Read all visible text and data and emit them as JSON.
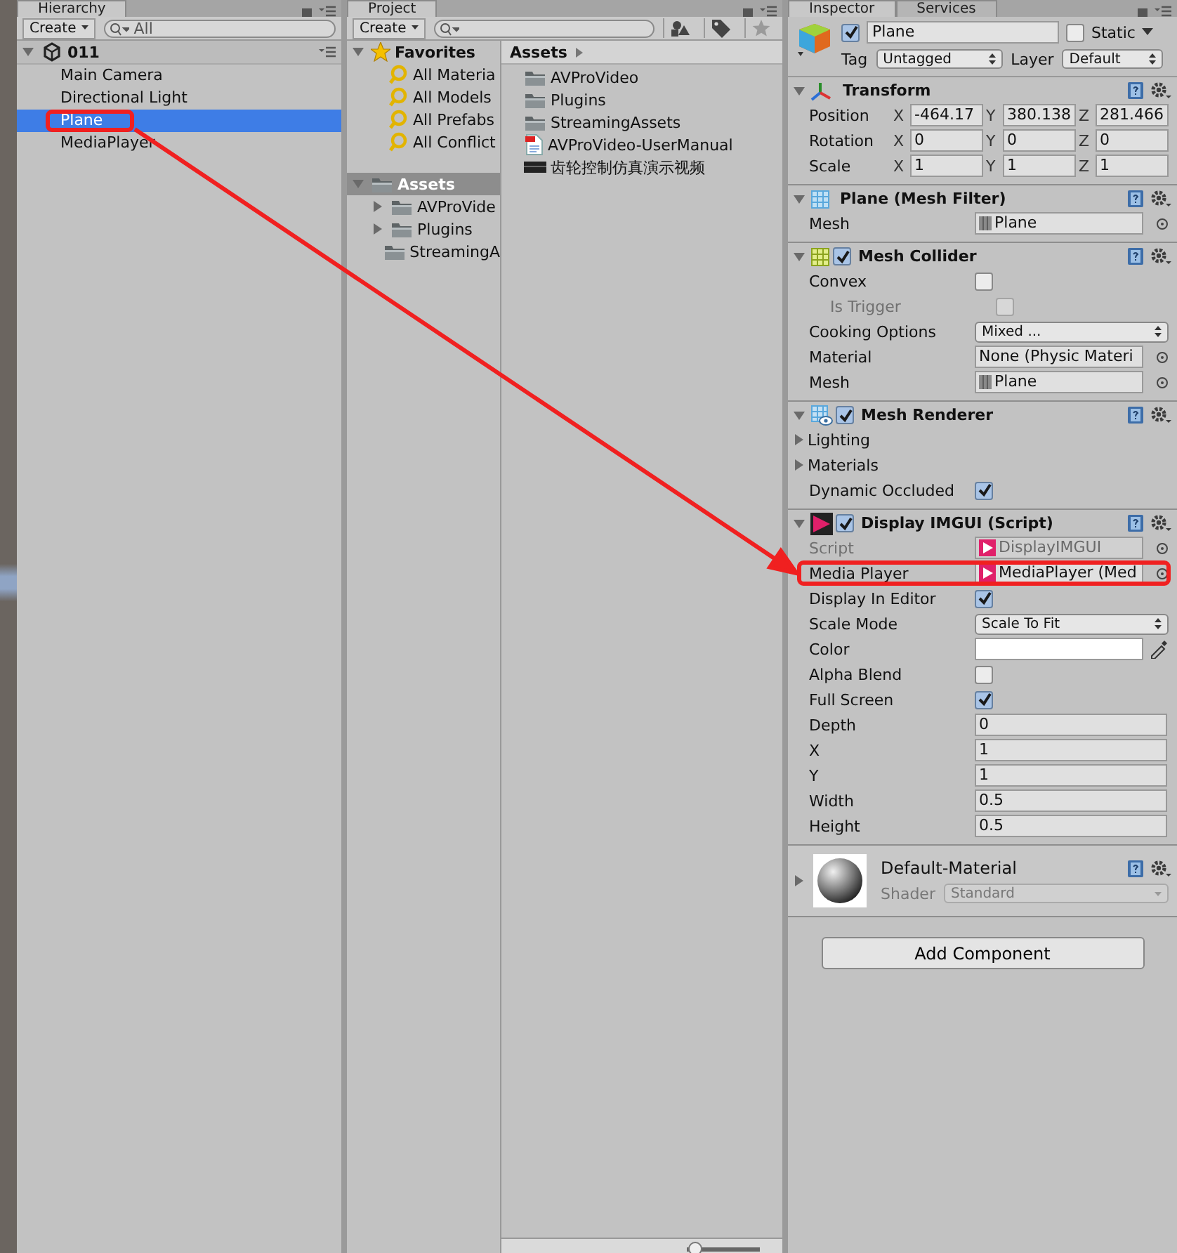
{
  "hierarchy": {
    "tab": "Hierarchy",
    "create": "Create",
    "search_placeholder": "All",
    "scene": {
      "name": "011",
      "expanded": true
    },
    "items": [
      {
        "label": "Main Camera",
        "selected": false
      },
      {
        "label": "Directional Light",
        "selected": false
      },
      {
        "label": "Plane",
        "selected": true
      },
      {
        "label": "MediaPlayer",
        "selected": false
      }
    ]
  },
  "project": {
    "tab": "Project",
    "create": "Create",
    "favorites": {
      "label": "Favorites",
      "expanded": true,
      "items": [
        "All Materia",
        "All Models",
        "All Prefabs",
        "All Conflict"
      ]
    },
    "assets": {
      "label": "Assets",
      "expanded": true,
      "selected": true,
      "children": [
        {
          "label": "AVProVide",
          "expandable": true
        },
        {
          "label": "Plugins",
          "expandable": true
        },
        {
          "label": "StreamingA",
          "expandable": false
        }
      ]
    },
    "breadcrumb": "Assets",
    "files": [
      {
        "name": "AVProVideo",
        "kind": "folder"
      },
      {
        "name": "Plugins",
        "kind": "folder"
      },
      {
        "name": "StreamingAssets",
        "kind": "folder"
      },
      {
        "name": "AVProVideo-UserManual",
        "kind": "pdf"
      },
      {
        "name": "齿轮控制仿真演示视频",
        "kind": "video"
      }
    ],
    "size_slider": {
      "level": 0.1
    }
  },
  "inspector": {
    "tabs": [
      {
        "label": "Inspector",
        "selected": true
      },
      {
        "label": "Services",
        "selected": false
      }
    ],
    "object": {
      "active": true,
      "name": "Plane",
      "static": false,
      "static_label": "Static",
      "tag_label": "Tag",
      "tag": "Untagged",
      "layer_label": "Layer",
      "layer": "Default"
    },
    "components": [
      {
        "title": "Transform",
        "kind": "transform",
        "expanded": true,
        "rows": [
          {
            "kind": "vector3",
            "label": "Position",
            "values": [
              {
                "axis": "X",
                "value": "-464.17"
              },
              {
                "axis": "Y",
                "value": "380.138"
              },
              {
                "axis": "Z",
                "value": "281.466"
              }
            ]
          },
          {
            "kind": "vector3",
            "label": "Rotation",
            "values": [
              {
                "axis": "X",
                "value": "0"
              },
              {
                "axis": "Y",
                "value": "0"
              },
              {
                "axis": "Z",
                "value": "0"
              }
            ]
          },
          {
            "kind": "vector3",
            "label": "Scale",
            "values": [
              {
                "axis": "X",
                "value": "1"
              },
              {
                "axis": "Y",
                "value": "1"
              },
              {
                "axis": "Z",
                "value": "1"
              }
            ]
          }
        ]
      },
      {
        "title": "Plane (Mesh Filter)",
        "kind": "mesh",
        "expanded": true,
        "rows": [
          {
            "kind": "meshref",
            "label": "Mesh",
            "value": "Plane"
          }
        ]
      },
      {
        "title": "Mesh Collider",
        "kind": "collider",
        "enabled": true,
        "expanded": true,
        "rows": [
          {
            "kind": "checkbox",
            "label": "Convex",
            "checked": false,
            "children": [
              {
                "kind": "checkbox",
                "label": "Is Trigger",
                "checked": false,
                "disabled": true
              }
            ]
          },
          {
            "kind": "dropdown",
            "label": "Cooking Options",
            "value": "Mixed ..."
          },
          {
            "kind": "object",
            "label": "Material",
            "value": "None (Physic Materi"
          },
          {
            "kind": "meshref",
            "label": "Mesh",
            "value": "Plane"
          }
        ]
      },
      {
        "title": "Mesh Renderer",
        "kind": "renderer",
        "enabled": true,
        "expanded": true,
        "rows": [
          {
            "kind": "foldout",
            "label": "Lighting",
            "expanded": false
          },
          {
            "kind": "foldout",
            "label": "Materials",
            "expanded": false
          },
          {
            "kind": "checkbox",
            "label": "Dynamic Occluded",
            "checked": true
          }
        ]
      },
      {
        "title": "Display IMGUI (Script)",
        "kind": "script",
        "enabled": true,
        "expanded": true,
        "rows": [
          {
            "kind": "scriptref",
            "label": "Script",
            "value": "DisplayIMGUI",
            "disabled": true
          },
          {
            "kind": "scriptref",
            "label": "Media Player",
            "value": "MediaPlayer (Med"
          },
          {
            "kind": "checkbox",
            "label": "Display In Editor",
            "checked": true
          },
          {
            "kind": "dropdown",
            "label": "Scale Mode",
            "value": "Scale To Fit"
          },
          {
            "kind": "color",
            "label": "Color",
            "color": "#ffffff"
          },
          {
            "kind": "checkbox",
            "label": "Alpha Blend",
            "checked": false
          },
          {
            "kind": "checkbox",
            "label": "Full Screen",
            "checked": true
          },
          {
            "kind": "number",
            "label": "Depth",
            "value": "0"
          },
          {
            "kind": "number",
            "label": "X",
            "value": "1"
          },
          {
            "kind": "number",
            "label": "Y",
            "value": "1"
          },
          {
            "kind": "number",
            "label": "Width",
            "value": "0.5"
          },
          {
            "kind": "number",
            "label": "Height",
            "value": "0.5"
          }
        ]
      }
    ],
    "material": {
      "name": "Default-Material",
      "expanded": false,
      "shader_label": "Shader",
      "shader": "Standard"
    },
    "add_button": "Add Component"
  }
}
